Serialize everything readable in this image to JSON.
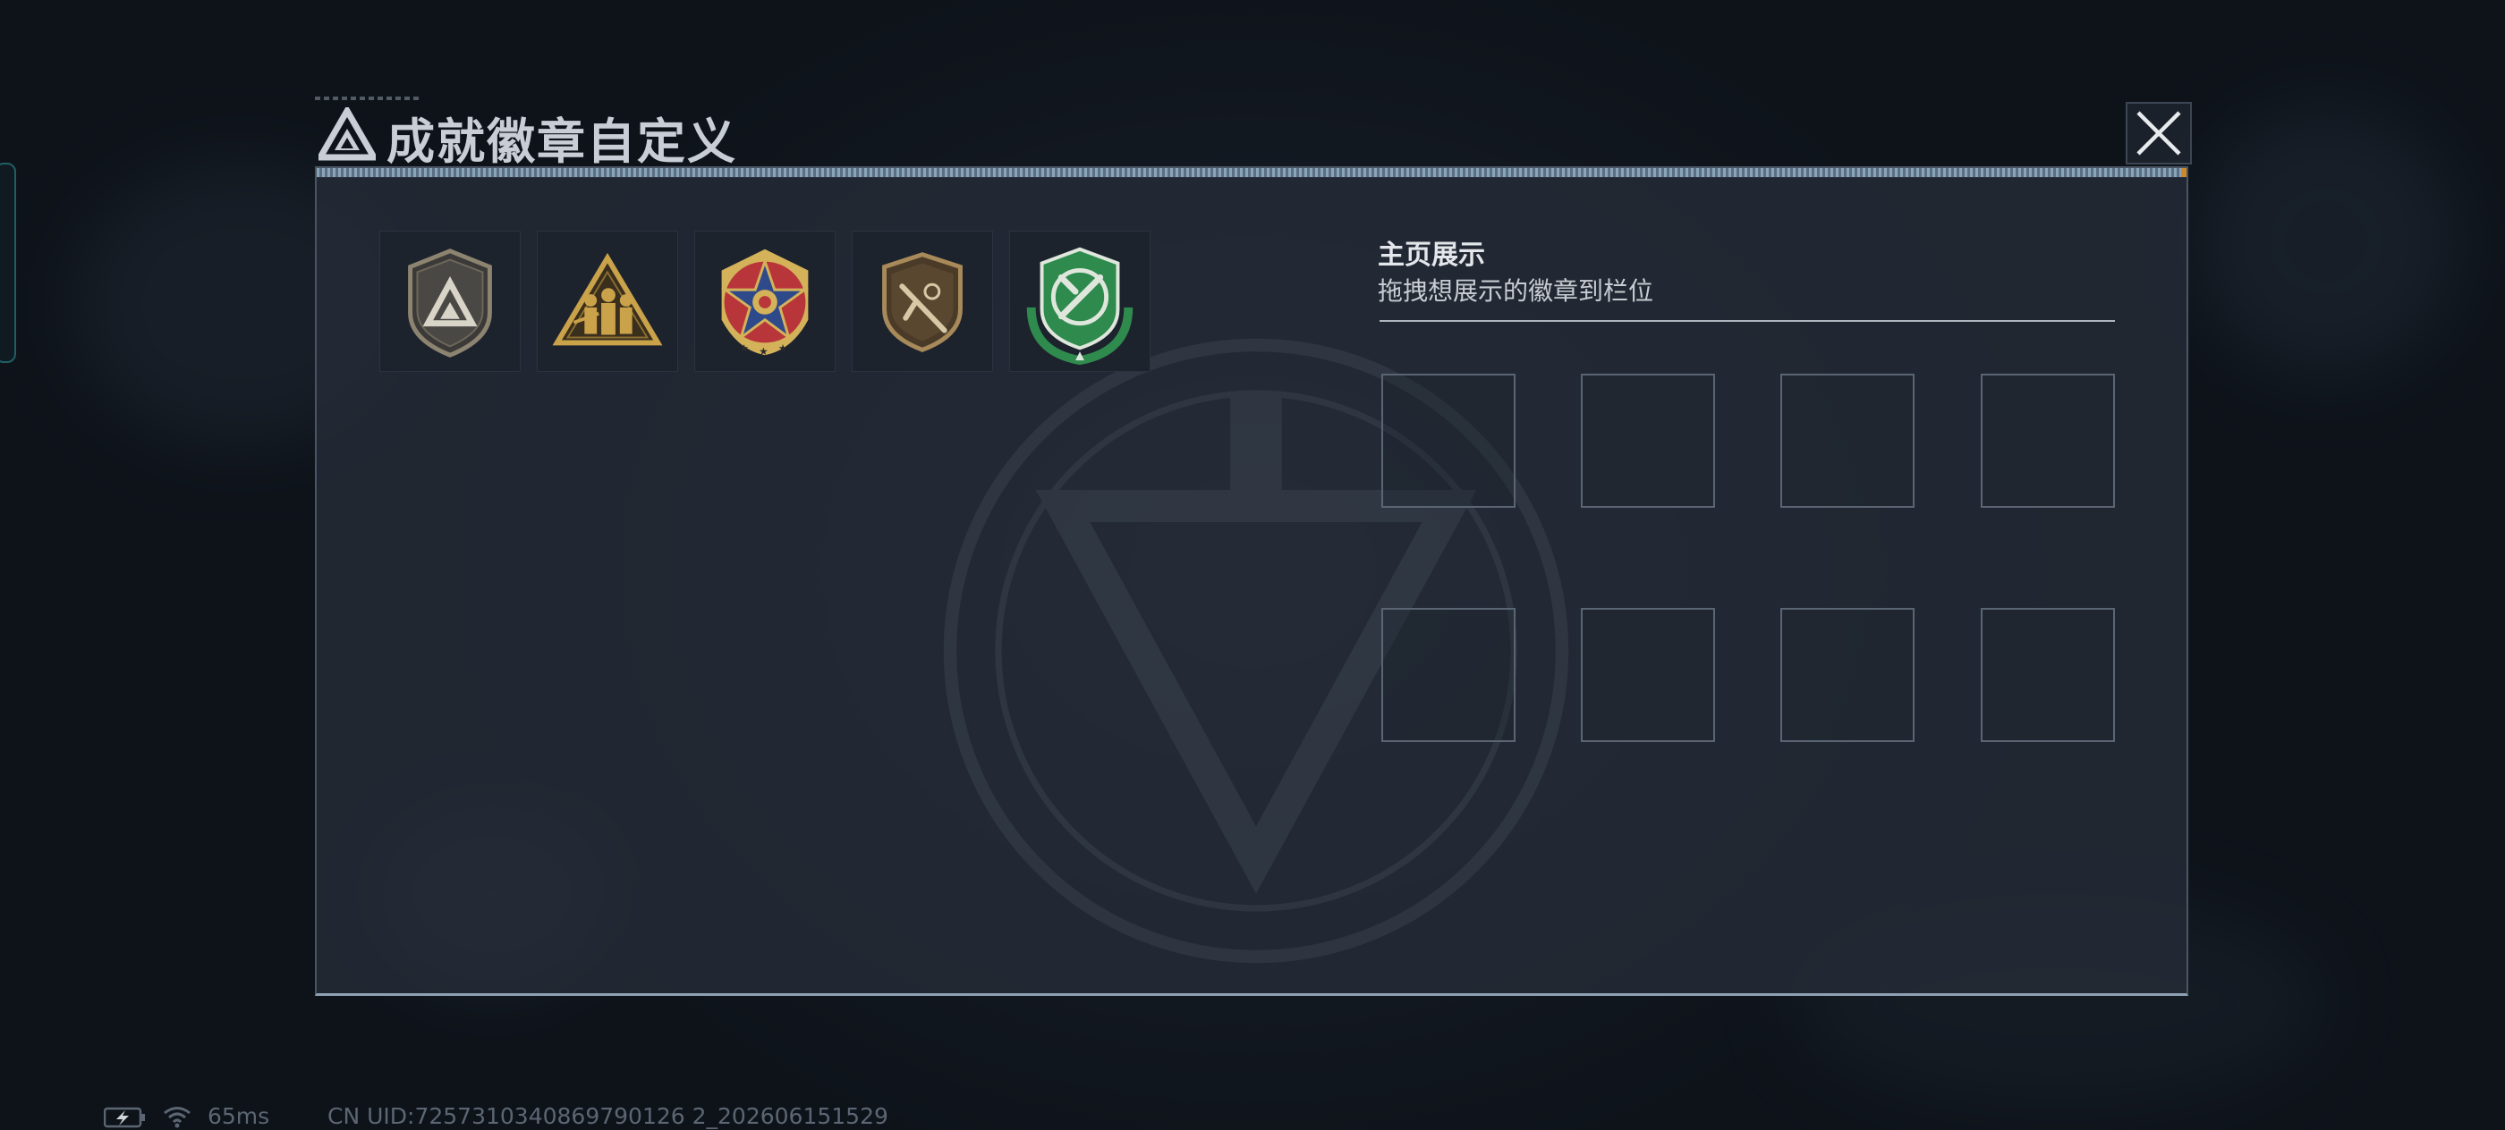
{
  "dialog": {
    "title": "成就徽章自定义",
    "close_icon": "close-icon",
    "title_icon": "triangle-logo-icon"
  },
  "badges": [
    {
      "icon": "shield-triangle-badge-icon",
      "colors": [
        "#8c8470",
        "#3b3a38"
      ]
    },
    {
      "icon": "soldiers-triangle-badge-icon",
      "colors": [
        "#c9a24a",
        "#3a2e1c"
      ]
    },
    {
      "icon": "star-medal-badge-icon",
      "colors": [
        "#c23a3a",
        "#2e4a8a",
        "#d4b25a"
      ]
    },
    {
      "icon": "rifle-shield-badge-icon",
      "colors": [
        "#a88a5a",
        "#4a3a28"
      ]
    },
    {
      "icon": "crossed-knife-green-badge-icon",
      "colors": [
        "#2f8a4e",
        "#dfe7dc"
      ]
    }
  ],
  "display": {
    "title": "主页展示",
    "hint": "拖拽想展示的徽章到栏位",
    "slot_count": 8
  },
  "status": {
    "ping": "65ms",
    "uid": "CN UID:7257310340869790126 2_202606151529",
    "battery_icon": "battery-charging-icon",
    "wifi_icon": "wifi-icon"
  },
  "colors": {
    "panel_bg": "#262d39",
    "accent_bar": "#8aa4b8",
    "accent_orange": "#d0892a",
    "text_primary": "#e3e6ea"
  }
}
